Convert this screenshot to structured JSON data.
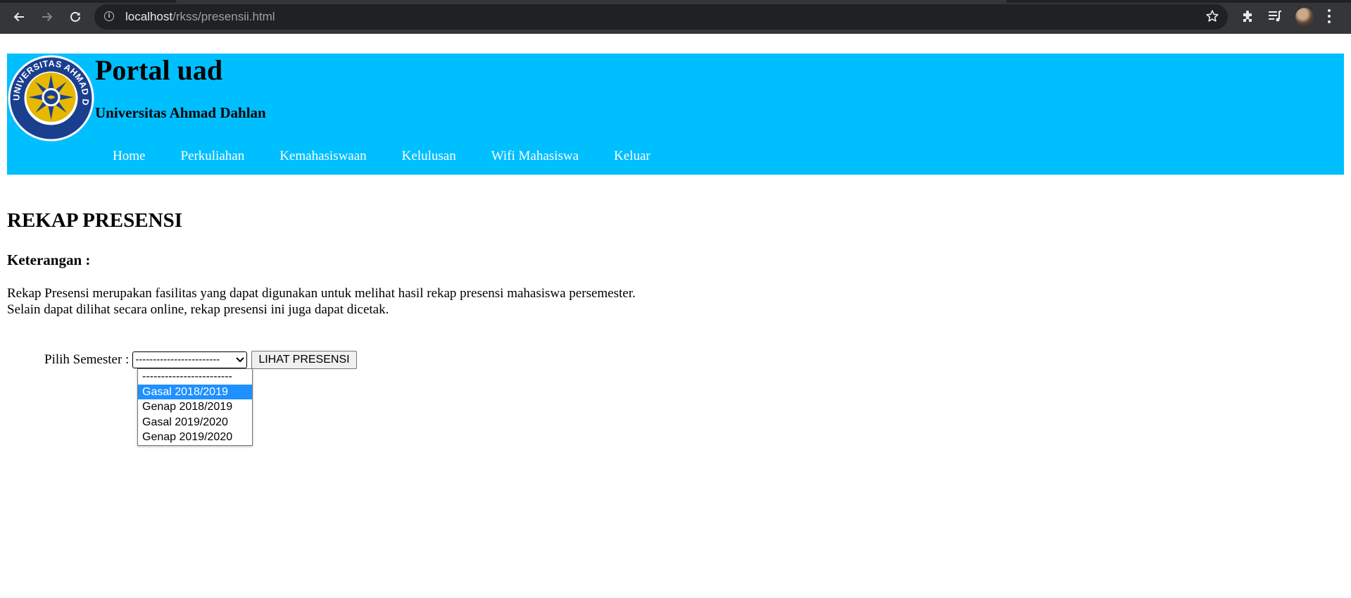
{
  "browser": {
    "url_host": "localhost",
    "url_path": "/rkss/presensii.html",
    "info_glyph": "i",
    "icons": [
      "back-arrow-icon",
      "forward-arrow-icon",
      "reload-icon",
      "info-icon",
      "bookmark-star-icon",
      "extensions-puzzle-icon",
      "reading-list-icon",
      "profile-avatar",
      "more-menu-icon"
    ]
  },
  "header": {
    "title": "Portal uad",
    "subtitle": "Universitas Ahmad Dahlan",
    "bg_color": "#00bfff",
    "nav": [
      {
        "label": "Home"
      },
      {
        "label": "Perkuliahan"
      },
      {
        "label": "Kemahasiswaan"
      },
      {
        "label": "Kelulusan"
      },
      {
        "label": "Wifi Mahasiswa"
      },
      {
        "label": "Keluar"
      }
    ]
  },
  "main": {
    "heading": "REKAP PRESENSI",
    "subheading": "Keterangan :",
    "description": [
      "Rekap Presensi merupakan fasilitas yang dapat digunakan untuk melihat hasil rekap presensi mahasiswa persemester.",
      "Selain dapat dilihat secara online, rekap presensi ini juga dapat dicetak."
    ],
    "semester_label": "Pilih Semester :",
    "semester_selected": "------------------------",
    "semester_options": [
      "------------------------",
      "Gasal 2018/2019",
      "Genap 2018/2019",
      "Gasal 2019/2020",
      "Genap 2019/2020"
    ],
    "highlighted_option": "Gasal 2018/2019",
    "button_label": "LIHAT PRESENSI"
  }
}
